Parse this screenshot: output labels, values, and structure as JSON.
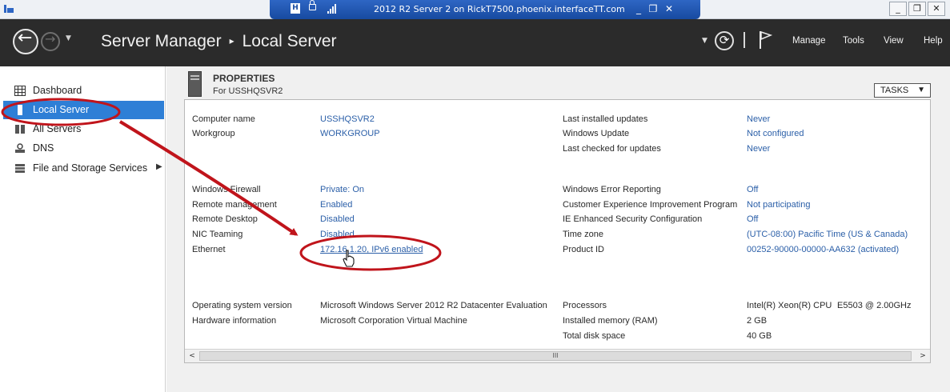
{
  "rdp": {
    "title": "2012 R2 Server 2 on RickT7500.phoenix.interfaceTT.com",
    "controls": {
      "minimize": "_",
      "restore": "❐",
      "close": "✕"
    }
  },
  "window_controls": {
    "minimize": "_",
    "restore": "❐",
    "close": "✕"
  },
  "header": {
    "app_title": "Server Manager",
    "separator": "▸",
    "page_title": "Local Server",
    "menu": [
      "Manage",
      "Tools",
      "View",
      "Help"
    ]
  },
  "sidebar": {
    "items": [
      {
        "label": "Dashboard",
        "icon": "dashboard-grid-icon"
      },
      {
        "label": "Local Server",
        "icon": "server-icon",
        "selected": true
      },
      {
        "label": "All Servers",
        "icon": "servers-icon"
      },
      {
        "label": "DNS",
        "icon": "dns-icon"
      },
      {
        "label": "File and Storage Services",
        "icon": "storage-icon",
        "has_children": true
      }
    ]
  },
  "properties": {
    "title": "PROPERTIES",
    "subtitle": "For USSHQSVR2",
    "tasks_label": "TASKS",
    "left": [
      {
        "label": "Computer name",
        "value": "USSHQSVR2"
      },
      {
        "label": "Workgroup",
        "value": "WORKGROUP"
      },
      {
        "label": "Windows Firewall",
        "value": "Private: On"
      },
      {
        "label": "Remote management",
        "value": "Enabled"
      },
      {
        "label": "Remote Desktop",
        "value": "Disabled"
      },
      {
        "label": "NIC Teaming",
        "value": "Disabled"
      },
      {
        "label": "Ethernet",
        "value": "172.16.1.20, IPv6 enabled"
      },
      {
        "label": "Operating system version",
        "value": "Microsoft Windows Server 2012 R2 Datacenter Evaluation"
      },
      {
        "label": "Hardware information",
        "value": "Microsoft Corporation Virtual Machine"
      }
    ],
    "right": [
      {
        "label": "Last installed updates",
        "value": "Never"
      },
      {
        "label": "Windows Update",
        "value": "Not configured"
      },
      {
        "label": "Last checked for updates",
        "value": "Never"
      },
      {
        "label": "Windows Error Reporting",
        "value": "Off"
      },
      {
        "label": "Customer Experience Improvement Program",
        "value": "Not participating"
      },
      {
        "label": "IE Enhanced Security Configuration",
        "value": "Off"
      },
      {
        "label": "Time zone",
        "value": "(UTC-08:00) Pacific Time (US & Canada)"
      },
      {
        "label": "Product ID",
        "value": "00252-90000-00000-AA632 (activated)"
      },
      {
        "label": "Processors",
        "value": "Intel(R) Xeon(R) CPU",
        "value2": "E5503  @ 2.00GHz"
      },
      {
        "label": "Installed memory (RAM)",
        "value": "2 GB"
      },
      {
        "label": "Total disk space",
        "value": "40 GB"
      }
    ]
  },
  "scrollbar": {
    "left": "<",
    "right": ">",
    "grip": "III"
  },
  "colors": {
    "header_bg": "#2b2b2b",
    "selected_bg": "#2e7fd6",
    "link": "#2b5fa8",
    "annotation": "#c0141b",
    "rdp_bar": "#1f55b3"
  }
}
